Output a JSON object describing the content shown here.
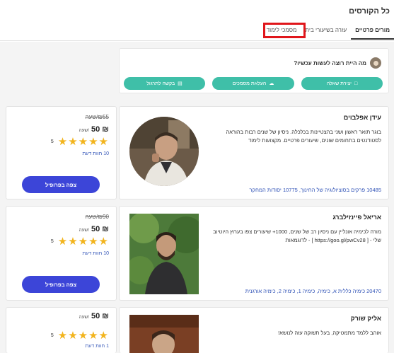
{
  "header": {
    "title": "כל הקורסים",
    "tabs": [
      "מסמכי לימוד",
      "עזרה בשיעורי בית",
      "מורים פרטיים"
    ]
  },
  "prompt": {
    "question": "מה היית רוצה לעשות עכשיו?",
    "buttons": [
      {
        "label": "יצירת שאלה",
        "icon": "chat-icon"
      },
      {
        "label": "העלאת מסמכים",
        "icon": "upload-cloud-icon"
      },
      {
        "label": "בקשה לתרגול",
        "icon": "document-icon"
      }
    ]
  },
  "teachers": [
    {
      "name": "עידן אפלבוים",
      "description": "בוגר תואר ראשון ושני בהצטיינות בכלכלה. ניסיון של שנים רבות בהוראה לסטודנטים בתחומים שונים, שיעורים פרטיים. מקצועות לימוד",
      "subjects": "10485 פרקים בסוציולוגיה של החינוך, 10775 יסודות המחקר",
      "price_old": "₪55/שעה",
      "price": "₪ 50",
      "price_unit": "/שעה",
      "rating_stars": "★★★★★",
      "rating_count": "5",
      "reviews": "10 חוות דעת",
      "profile_button": "צפה בפרופיל"
    },
    {
      "name": "אריאל פיינזילברג",
      "description": "מורה לכימיה אונליין עם ניסיון רב של שנים, 1000+ שיעורים צפו בערוץ היוטיוב שלי - [ https://goo.gl/pwCv28 ] - לדוגמאות",
      "subjects": "20470 כימיה כללית א, כימיה, כימיה 1, כימיה 2, כימיה אורגנית",
      "price_old": "₪90/שעה",
      "price": "₪ 50",
      "price_unit": "/שעה",
      "rating_stars": "★★★★★",
      "rating_count": "5",
      "reviews": "10 חוות דעת",
      "profile_button": "צפה בפרופיל"
    },
    {
      "name": "אליק שורק",
      "description": "אוהב ללמד מתמטיקה, בעל תשוקה עזה לנושא!",
      "price": "₪ 50",
      "price_unit": "/שעה",
      "rating_stars": "★★★★★",
      "rating_count": "5",
      "reviews": "1 חוות דעת"
    }
  ],
  "colors": {
    "teal": "#3fbfa8",
    "blue_button": "#3c45d8",
    "link": "#3456b8",
    "star": "#f2b41d",
    "highlight": "#e0161b"
  }
}
